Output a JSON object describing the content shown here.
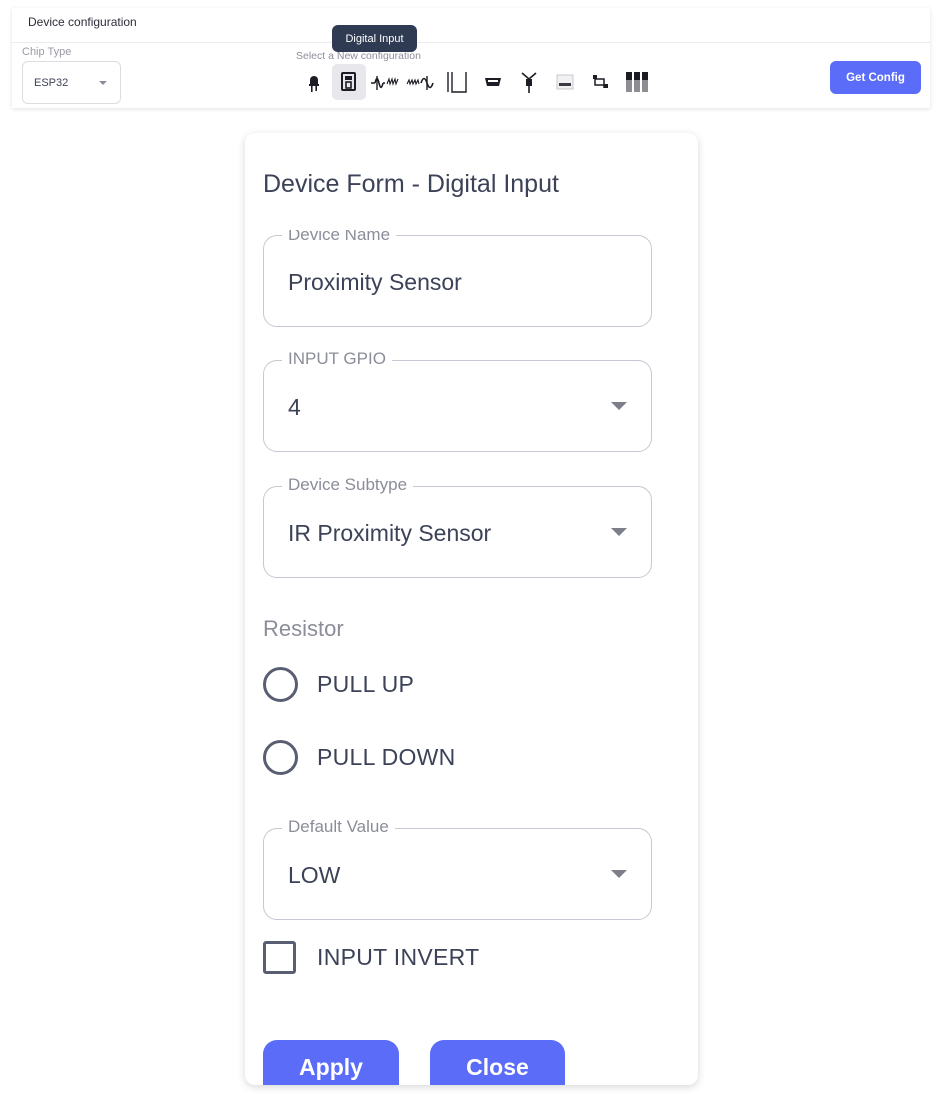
{
  "header": {
    "title": "Device configuration",
    "chip_type_label": "Chip Type",
    "chip_type_value": "ESP32",
    "config_hint": "Select a New configuration",
    "tooltip": "Digital Input",
    "get_config_label": "Get Config"
  },
  "device_icons": [
    {
      "name": "led-icon"
    },
    {
      "name": "digital-input-icon",
      "active": true
    },
    {
      "name": "pwm-icon"
    },
    {
      "name": "analog-input-icon"
    },
    {
      "name": "relay-icon"
    },
    {
      "name": "serial-port-icon"
    },
    {
      "name": "antenna-icon"
    },
    {
      "name": "bus-icon"
    },
    {
      "name": "i2c-icon"
    },
    {
      "name": "transistors-icon"
    }
  ],
  "form": {
    "title": "Device Form - Digital Input",
    "device_name": {
      "label": "Device Name",
      "value": "Proximity Sensor"
    },
    "input_gpio": {
      "label": "INPUT GPIO",
      "value": "4"
    },
    "device_subtype": {
      "label": "Device Subtype",
      "value": "IR Proximity Sensor"
    },
    "resistor_label": "Resistor",
    "resistor_options": [
      "PULL UP",
      "PULL DOWN"
    ],
    "default_value": {
      "label": "Default Value",
      "value": "LOW"
    },
    "input_invert_label": "INPUT INVERT",
    "apply_label": "Apply",
    "close_label": "Close"
  },
  "colors": {
    "accent": "#5b6cf9",
    "tooltip_bg": "#2f3b52",
    "text": "#3c4257",
    "muted": "#8b8d99"
  }
}
